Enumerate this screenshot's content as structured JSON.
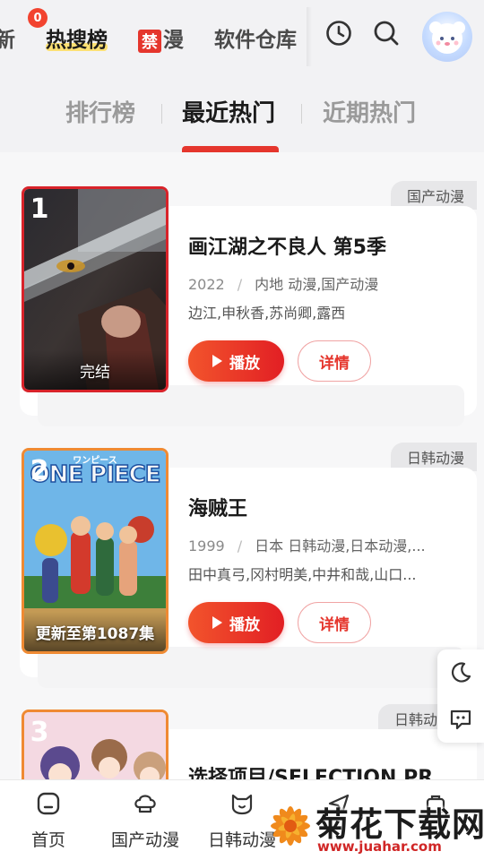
{
  "top_nav": {
    "tabs": [
      {
        "label": "新"
      },
      {
        "label": "热搜榜",
        "badge": "0"
      },
      {
        "ban_glyph": "禁",
        "label": "漫"
      },
      {
        "label": "软件仓库"
      }
    ]
  },
  "sub_tabs": [
    "排行榜",
    "最近热门",
    "近期热门"
  ],
  "items": [
    {
      "rank": "1",
      "category": "国产动漫",
      "title": "画江湖之不良人 第5季",
      "year": "2022",
      "meta": "内地 动漫,国产动漫",
      "cast": "边江,申秋香,苏尚卿,露西",
      "poster_caption": "完结",
      "play_label": "播放",
      "detail_label": "详情"
    },
    {
      "rank": "2",
      "category": "日韩动漫",
      "title": "海贼王",
      "year": "1999",
      "meta": "日本 日韩动漫,日本动漫,...",
      "cast": "田中真弓,冈村明美,中井和哉,山口...",
      "poster_caption": "更新至第1087集",
      "poster_logo": "ONE PIECE",
      "poster_logo_small": "ワンピース",
      "play_label": "播放",
      "detail_label": "详情"
    },
    {
      "rank": "3",
      "category": "日韩动",
      "title": "选择项目/SELECTION PR"
    }
  ],
  "bottom_nav": [
    {
      "label": "首页",
      "icon": "home-icon"
    },
    {
      "label": "国产动漫",
      "icon": "chef-hat-icon"
    },
    {
      "label": "日韩动漫",
      "icon": "cat-face-icon"
    }
  ],
  "watermark": {
    "text": "菊花下载网",
    "url": "www.juahar.com"
  },
  "colors": {
    "accent": "#e5362d",
    "rank1_border": "#d8232a",
    "rank2_border": "#ef8a33"
  }
}
